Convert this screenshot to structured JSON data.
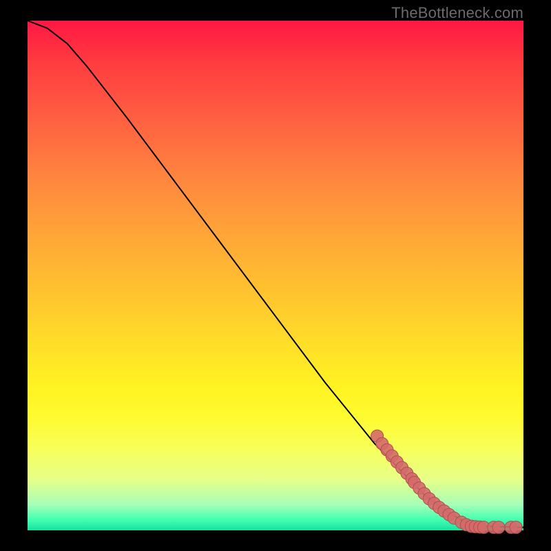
{
  "watermark": "TheBottleneck.com",
  "chart_data": {
    "type": "line",
    "title": "",
    "xlabel": "",
    "ylabel": "",
    "xlim": [
      0,
      100
    ],
    "ylim": [
      0,
      100
    ],
    "curve": [
      {
        "x": 0,
        "y": 100
      },
      {
        "x": 4,
        "y": 98.5
      },
      {
        "x": 8,
        "y": 95.5
      },
      {
        "x": 12,
        "y": 91
      },
      {
        "x": 20,
        "y": 81
      },
      {
        "x": 30,
        "y": 68
      },
      {
        "x": 40,
        "y": 55
      },
      {
        "x": 50,
        "y": 42
      },
      {
        "x": 60,
        "y": 29
      },
      {
        "x": 70,
        "y": 17
      },
      {
        "x": 76,
        "y": 11
      },
      {
        "x": 80,
        "y": 7
      },
      {
        "x": 84,
        "y": 4
      },
      {
        "x": 88,
        "y": 1.8
      },
      {
        "x": 92,
        "y": 0.8
      },
      {
        "x": 100,
        "y": 0.6
      }
    ],
    "points": [
      {
        "x": 70.5,
        "y": 18.5
      },
      {
        "x": 71.5,
        "y": 17.0
      },
      {
        "x": 72.5,
        "y": 15.8
      },
      {
        "x": 73.5,
        "y": 14.6
      },
      {
        "x": 74.5,
        "y": 13.4
      },
      {
        "x": 75.5,
        "y": 12.3
      },
      {
        "x": 76.5,
        "y": 11.2
      },
      {
        "x": 77.5,
        "y": 10.1
      },
      {
        "x": 78.0,
        "y": 9.4
      },
      {
        "x": 79.0,
        "y": 8.3
      },
      {
        "x": 80.0,
        "y": 7.2
      },
      {
        "x": 81.0,
        "y": 6.2
      },
      {
        "x": 82.0,
        "y": 5.3
      },
      {
        "x": 83.0,
        "y": 4.5
      },
      {
        "x": 84.0,
        "y": 3.8
      },
      {
        "x": 85.0,
        "y": 3.1
      },
      {
        "x": 86.0,
        "y": 2.4
      },
      {
        "x": 87.5,
        "y": 1.6
      },
      {
        "x": 88.5,
        "y": 1.1
      },
      {
        "x": 89.5,
        "y": 0.8
      },
      {
        "x": 90.3,
        "y": 0.7
      },
      {
        "x": 91.2,
        "y": 0.65
      },
      {
        "x": 92.0,
        "y": 0.6
      },
      {
        "x": 94.0,
        "y": 0.6
      },
      {
        "x": 95.0,
        "y": 0.6
      },
      {
        "x": 97.5,
        "y": 0.6
      },
      {
        "x": 98.5,
        "y": 0.6
      }
    ],
    "colors": {
      "curve": "#000000",
      "point_fill": "#d46a6a",
      "point_stroke": "#b04e4e"
    }
  }
}
